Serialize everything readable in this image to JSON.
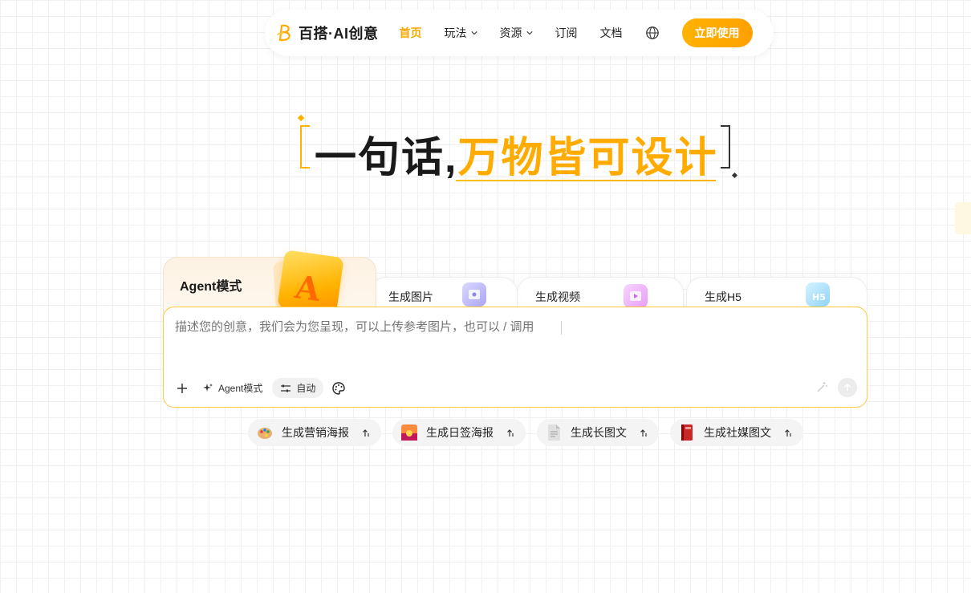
{
  "nav": {
    "logo_text": "百搭·AI创意",
    "items": [
      {
        "label": "首页",
        "active": true,
        "dropdown": false
      },
      {
        "label": "玩法",
        "active": false,
        "dropdown": true
      },
      {
        "label": "资源",
        "active": false,
        "dropdown": true
      },
      {
        "label": "订阅",
        "active": false,
        "dropdown": false
      },
      {
        "label": "文档",
        "active": false,
        "dropdown": false
      }
    ],
    "language_icon": "globe-icon",
    "cta_label": "立即使用"
  },
  "hero": {
    "title_dark": "一句话,",
    "title_accent": "万物皆可设计"
  },
  "tabs": [
    {
      "label": "Agent模式",
      "active": true,
      "icon": "agent-card-icon"
    },
    {
      "label": "生成图片",
      "active": false,
      "icon": "image-icon"
    },
    {
      "label": "生成视频",
      "active": false,
      "icon": "video-icon"
    },
    {
      "label": "生成H5",
      "active": false,
      "icon": "h5-icon"
    }
  ],
  "agent_tab_letter": "A",
  "input": {
    "placeholder": "描述您的创意，我们会为您呈现，可以上传参考图片，也可以 / 调用",
    "value": "",
    "toolbar": {
      "add_icon": "plus-icon",
      "agent_mode_label": "Agent模式",
      "auto_label": "自动",
      "palette_icon": "palette-icon"
    },
    "magic_icon": "sparkle-icon",
    "send_icon": "arrow-up-icon"
  },
  "suggestions": [
    {
      "label": "生成营销海报",
      "icon": "palette-emoji-icon"
    },
    {
      "label": "生成日签海报",
      "icon": "sunset-emoji-icon"
    },
    {
      "label": "生成长图文",
      "icon": "document-emoji-icon"
    },
    {
      "label": "生成社媒图文",
      "icon": "red-book-emoji-icon"
    }
  ],
  "colors": {
    "accent": "#ffab00",
    "cta_bg": "#ffb300",
    "input_border": "#ffc93a",
    "chip_bg": "#f4f4f4"
  }
}
